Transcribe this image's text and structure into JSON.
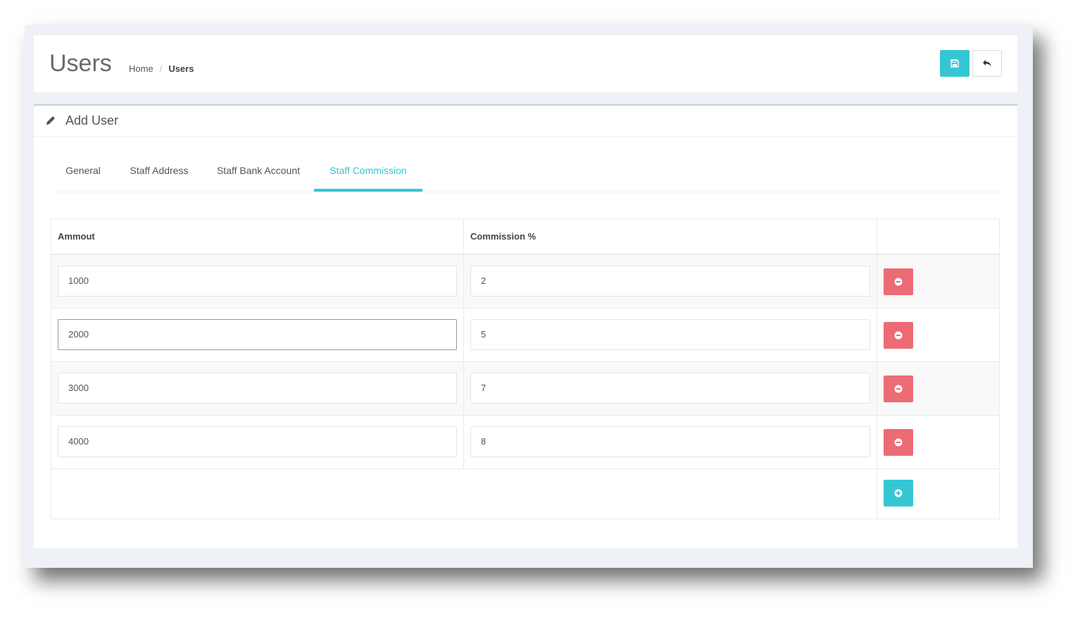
{
  "header": {
    "title": "Users",
    "breadcrumb": {
      "home": "Home",
      "separator": "/",
      "current": "Users"
    },
    "actions": {
      "save_icon": "floppy-disk-icon",
      "back_icon": "undo-arrow-icon"
    }
  },
  "portlet": {
    "caption": "Add User",
    "caption_icon": "pencil-icon"
  },
  "tabs": [
    {
      "label": "General",
      "active": false
    },
    {
      "label": "Staff Address",
      "active": false
    },
    {
      "label": "Staff Bank Account",
      "active": false
    },
    {
      "label": "Staff Commission",
      "active": true
    }
  ],
  "commission_table": {
    "columns": [
      "Ammout",
      "Commission %",
      ""
    ],
    "rows": [
      {
        "amount": "1000",
        "commission": "2"
      },
      {
        "amount": "2000",
        "commission": "5"
      },
      {
        "amount": "3000",
        "commission": "7"
      },
      {
        "amount": "4000",
        "commission": "8"
      }
    ],
    "remove_icon": "minus-circle-icon",
    "add_icon": "plus-circle-icon"
  },
  "colors": {
    "accent": "#36c6d3",
    "danger": "#ed6b75",
    "background": "#eef1f5"
  }
}
